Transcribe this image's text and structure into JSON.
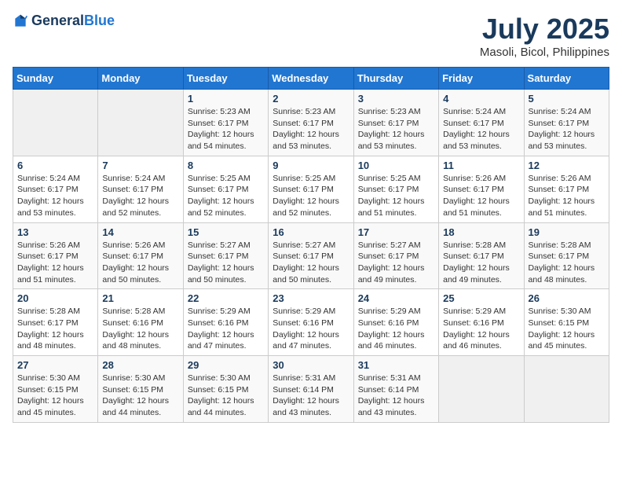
{
  "header": {
    "logo_general": "General",
    "logo_blue": "Blue",
    "month_year": "July 2025",
    "location": "Masoli, Bicol, Philippines"
  },
  "weekdays": [
    "Sunday",
    "Monday",
    "Tuesday",
    "Wednesday",
    "Thursday",
    "Friday",
    "Saturday"
  ],
  "weeks": [
    [
      {
        "day": "",
        "info": ""
      },
      {
        "day": "",
        "info": ""
      },
      {
        "day": "1",
        "info": "Sunrise: 5:23 AM\nSunset: 6:17 PM\nDaylight: 12 hours and 54 minutes."
      },
      {
        "day": "2",
        "info": "Sunrise: 5:23 AM\nSunset: 6:17 PM\nDaylight: 12 hours and 53 minutes."
      },
      {
        "day": "3",
        "info": "Sunrise: 5:23 AM\nSunset: 6:17 PM\nDaylight: 12 hours and 53 minutes."
      },
      {
        "day": "4",
        "info": "Sunrise: 5:24 AM\nSunset: 6:17 PM\nDaylight: 12 hours and 53 minutes."
      },
      {
        "day": "5",
        "info": "Sunrise: 5:24 AM\nSunset: 6:17 PM\nDaylight: 12 hours and 53 minutes."
      }
    ],
    [
      {
        "day": "6",
        "info": "Sunrise: 5:24 AM\nSunset: 6:17 PM\nDaylight: 12 hours and 53 minutes."
      },
      {
        "day": "7",
        "info": "Sunrise: 5:24 AM\nSunset: 6:17 PM\nDaylight: 12 hours and 52 minutes."
      },
      {
        "day": "8",
        "info": "Sunrise: 5:25 AM\nSunset: 6:17 PM\nDaylight: 12 hours and 52 minutes."
      },
      {
        "day": "9",
        "info": "Sunrise: 5:25 AM\nSunset: 6:17 PM\nDaylight: 12 hours and 52 minutes."
      },
      {
        "day": "10",
        "info": "Sunrise: 5:25 AM\nSunset: 6:17 PM\nDaylight: 12 hours and 51 minutes."
      },
      {
        "day": "11",
        "info": "Sunrise: 5:26 AM\nSunset: 6:17 PM\nDaylight: 12 hours and 51 minutes."
      },
      {
        "day": "12",
        "info": "Sunrise: 5:26 AM\nSunset: 6:17 PM\nDaylight: 12 hours and 51 minutes."
      }
    ],
    [
      {
        "day": "13",
        "info": "Sunrise: 5:26 AM\nSunset: 6:17 PM\nDaylight: 12 hours and 51 minutes."
      },
      {
        "day": "14",
        "info": "Sunrise: 5:26 AM\nSunset: 6:17 PM\nDaylight: 12 hours and 50 minutes."
      },
      {
        "day": "15",
        "info": "Sunrise: 5:27 AM\nSunset: 6:17 PM\nDaylight: 12 hours and 50 minutes."
      },
      {
        "day": "16",
        "info": "Sunrise: 5:27 AM\nSunset: 6:17 PM\nDaylight: 12 hours and 50 minutes."
      },
      {
        "day": "17",
        "info": "Sunrise: 5:27 AM\nSunset: 6:17 PM\nDaylight: 12 hours and 49 minutes."
      },
      {
        "day": "18",
        "info": "Sunrise: 5:28 AM\nSunset: 6:17 PM\nDaylight: 12 hours and 49 minutes."
      },
      {
        "day": "19",
        "info": "Sunrise: 5:28 AM\nSunset: 6:17 PM\nDaylight: 12 hours and 48 minutes."
      }
    ],
    [
      {
        "day": "20",
        "info": "Sunrise: 5:28 AM\nSunset: 6:17 PM\nDaylight: 12 hours and 48 minutes."
      },
      {
        "day": "21",
        "info": "Sunrise: 5:28 AM\nSunset: 6:16 PM\nDaylight: 12 hours and 48 minutes."
      },
      {
        "day": "22",
        "info": "Sunrise: 5:29 AM\nSunset: 6:16 PM\nDaylight: 12 hours and 47 minutes."
      },
      {
        "day": "23",
        "info": "Sunrise: 5:29 AM\nSunset: 6:16 PM\nDaylight: 12 hours and 47 minutes."
      },
      {
        "day": "24",
        "info": "Sunrise: 5:29 AM\nSunset: 6:16 PM\nDaylight: 12 hours and 46 minutes."
      },
      {
        "day": "25",
        "info": "Sunrise: 5:29 AM\nSunset: 6:16 PM\nDaylight: 12 hours and 46 minutes."
      },
      {
        "day": "26",
        "info": "Sunrise: 5:30 AM\nSunset: 6:15 PM\nDaylight: 12 hours and 45 minutes."
      }
    ],
    [
      {
        "day": "27",
        "info": "Sunrise: 5:30 AM\nSunset: 6:15 PM\nDaylight: 12 hours and 45 minutes."
      },
      {
        "day": "28",
        "info": "Sunrise: 5:30 AM\nSunset: 6:15 PM\nDaylight: 12 hours and 44 minutes."
      },
      {
        "day": "29",
        "info": "Sunrise: 5:30 AM\nSunset: 6:15 PM\nDaylight: 12 hours and 44 minutes."
      },
      {
        "day": "30",
        "info": "Sunrise: 5:31 AM\nSunset: 6:14 PM\nDaylight: 12 hours and 43 minutes."
      },
      {
        "day": "31",
        "info": "Sunrise: 5:31 AM\nSunset: 6:14 PM\nDaylight: 12 hours and 43 minutes."
      },
      {
        "day": "",
        "info": ""
      },
      {
        "day": "",
        "info": ""
      }
    ]
  ]
}
